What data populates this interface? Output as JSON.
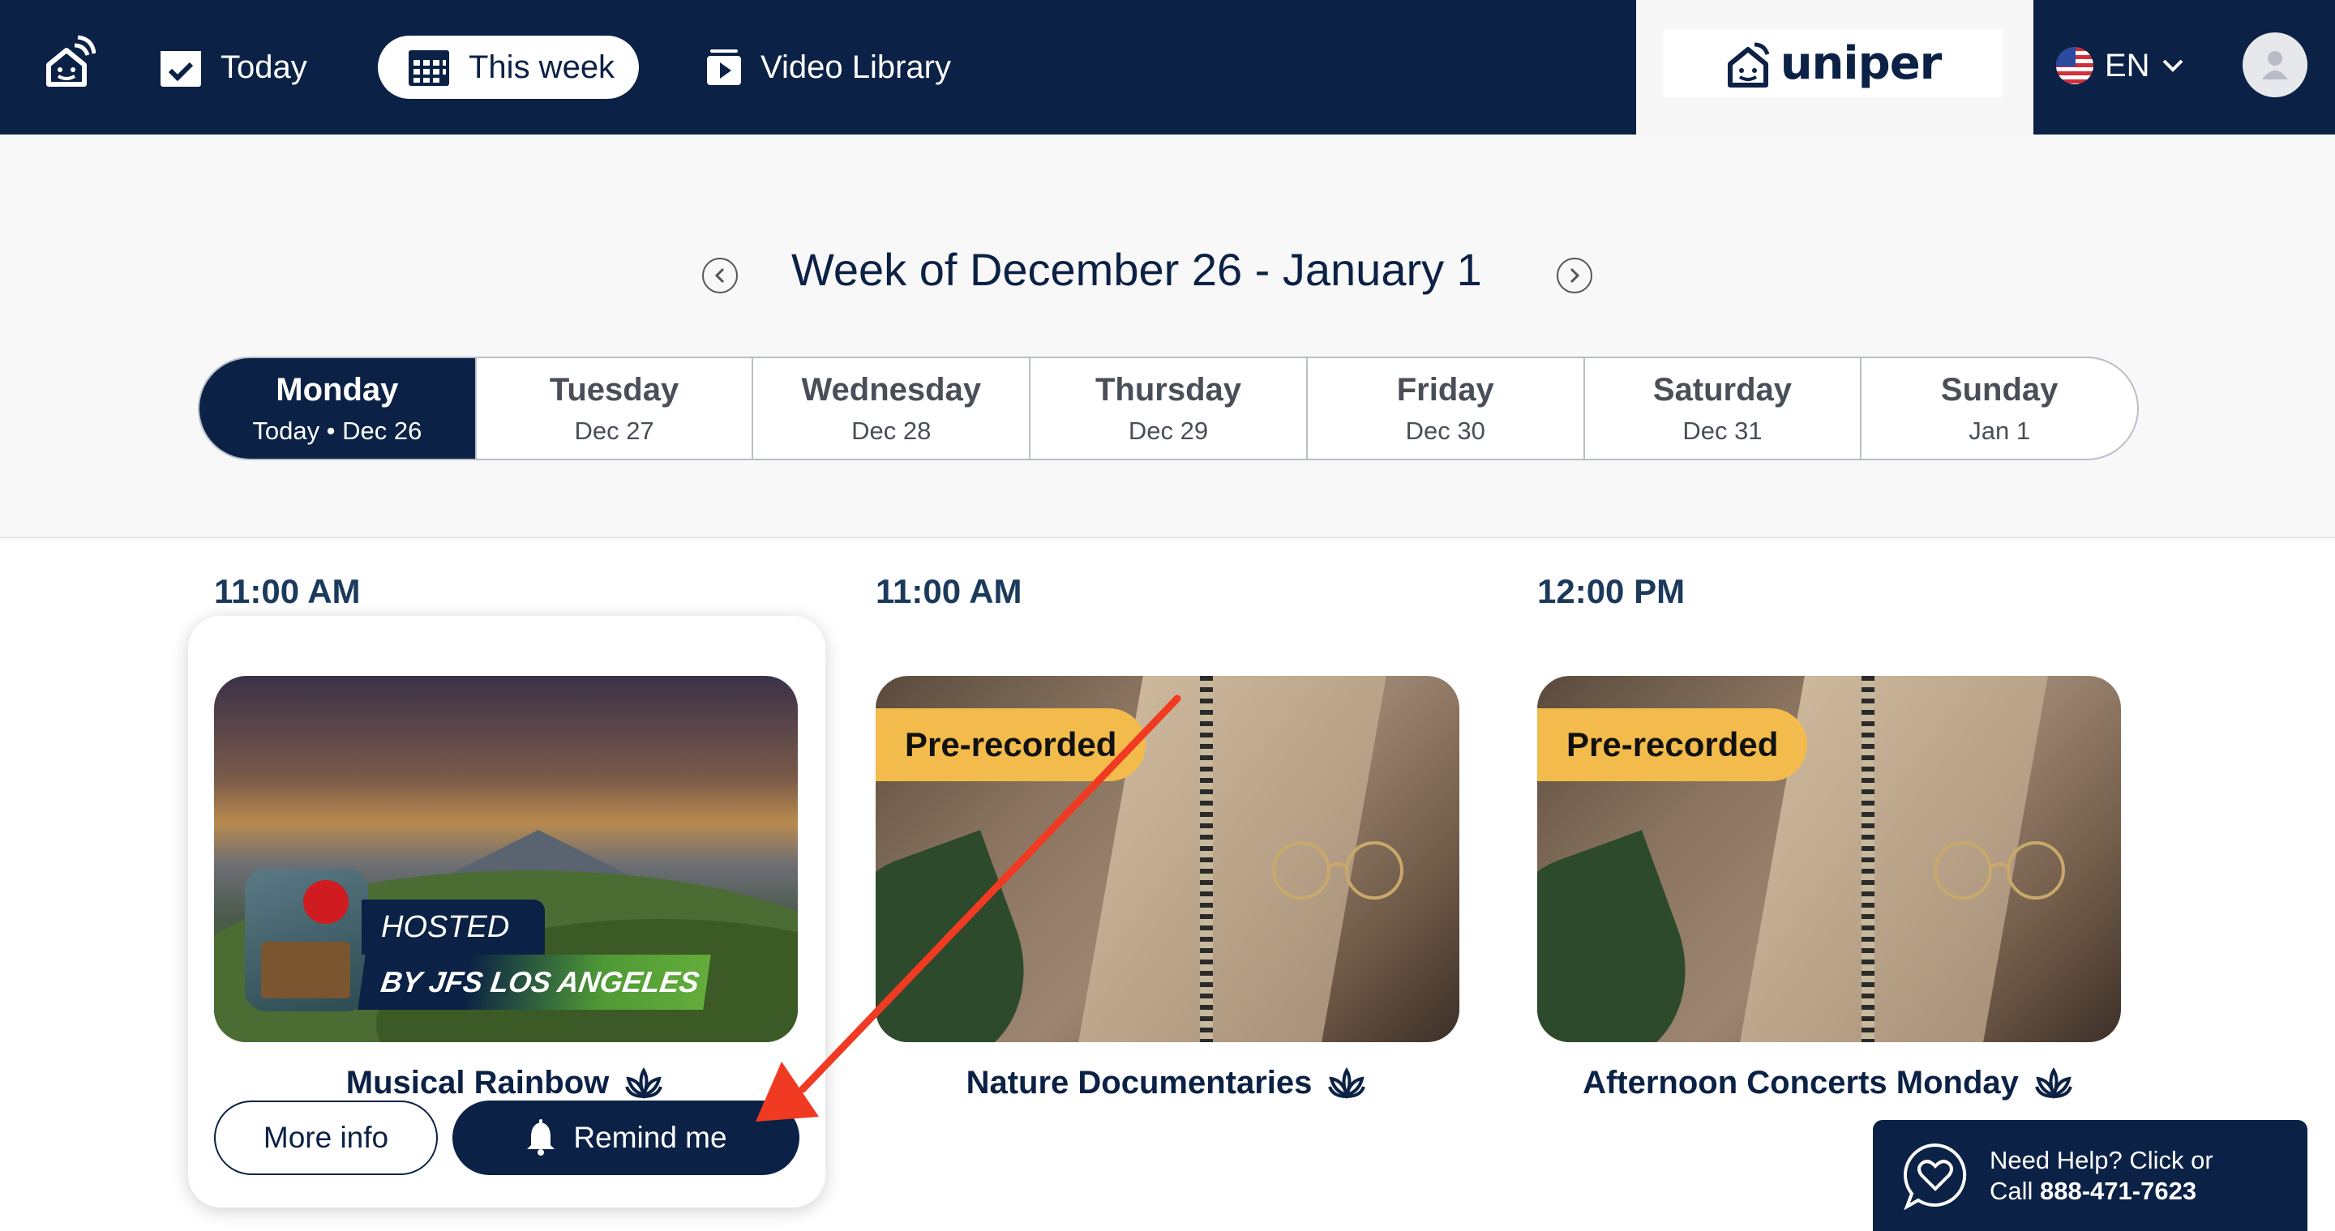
{
  "nav": {
    "today_label": "Today",
    "week_label": "This week",
    "video_label": "Video Library",
    "brand": "uniper",
    "language": "EN"
  },
  "week": {
    "title": "Week of December 26 - January 1",
    "days": [
      {
        "name": "Monday",
        "date": "Today • Dec 26",
        "active": true
      },
      {
        "name": "Tuesday",
        "date": "Dec 27"
      },
      {
        "name": "Wednesday",
        "date": "Dec 28"
      },
      {
        "name": "Thursday",
        "date": "Dec 29"
      },
      {
        "name": "Friday",
        "date": "Dec 30"
      },
      {
        "name": "Saturday",
        "date": "Dec 31"
      },
      {
        "name": "Sunday",
        "date": "Jan 1"
      }
    ]
  },
  "events": [
    {
      "time": "11:00 AM",
      "title": "Musical Rainbow",
      "host_line_1": "HOSTED",
      "host_line_2": "BY JFS LOS ANGELES",
      "more_info_label": "More info",
      "remind_label": "Remind me"
    },
    {
      "time": "11:00 AM",
      "title": "Nature Documentaries",
      "badge": "Pre-recorded"
    },
    {
      "time": "12:00 PM",
      "title": "Afternoon Concerts Monday",
      "badge": "Pre-recorded"
    }
  ],
  "help": {
    "line_1": "Need Help? Click or",
    "line_2_prefix": "Call ",
    "phone": "888-471-7623"
  },
  "colors": {
    "navy": "#0b2145",
    "badge_yellow": "#f3bb4c",
    "annotation_red": "#f03a22",
    "host_green": "#63ac3b"
  }
}
